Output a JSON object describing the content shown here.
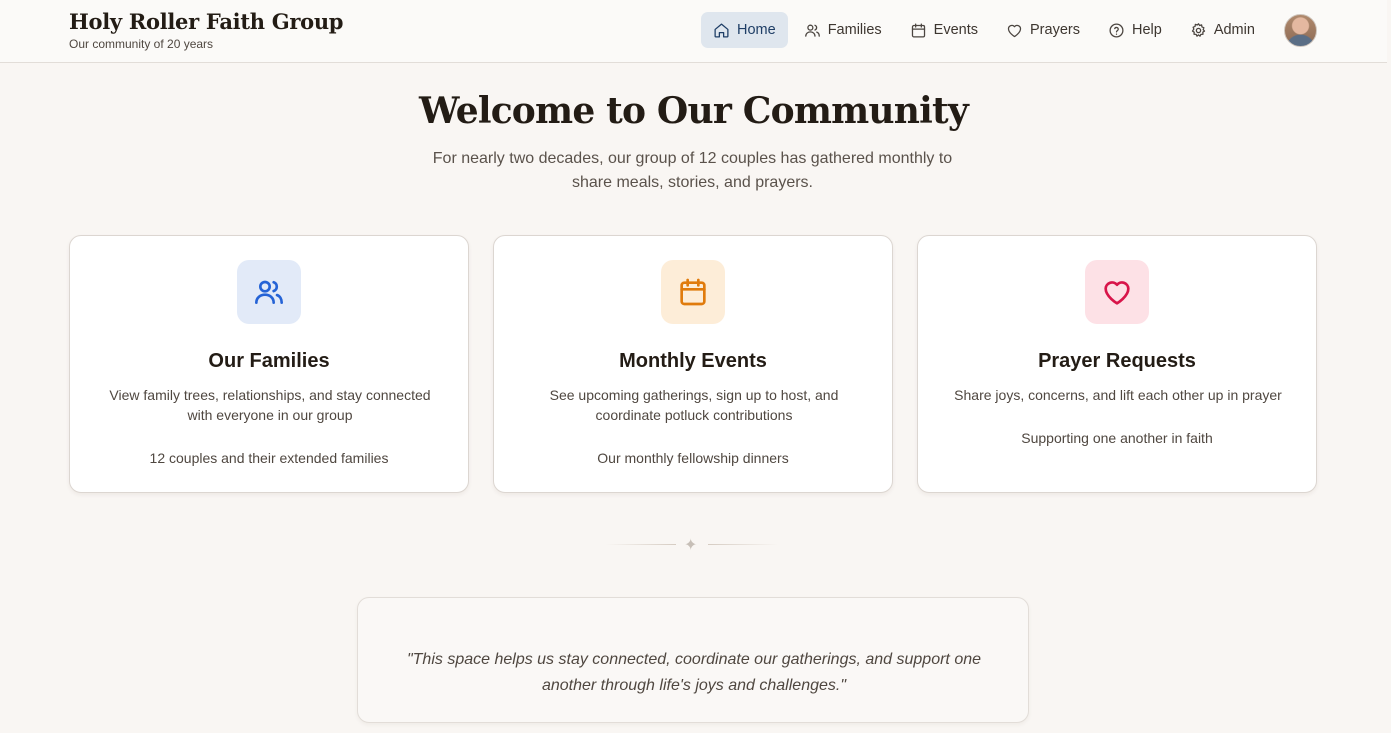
{
  "brand": {
    "title": "Holy Roller Faith Group",
    "subtitle": "Our community of 20 years"
  },
  "nav": {
    "items": [
      {
        "label": "Home",
        "icon": "home-icon",
        "active": true
      },
      {
        "label": "Families",
        "icon": "users-icon",
        "active": false
      },
      {
        "label": "Events",
        "icon": "calendar-icon",
        "active": false
      },
      {
        "label": "Prayers",
        "icon": "heart-icon",
        "active": false
      },
      {
        "label": "Help",
        "icon": "help-circle-icon",
        "active": false
      },
      {
        "label": "Admin",
        "icon": "gear-icon",
        "active": false
      }
    ],
    "active_color": "#1f3e66"
  },
  "hero": {
    "title": "Welcome to Our Community",
    "subtitle": "For nearly two decades, our group of 12 couples has gathered monthly to share meals, stories, and prayers."
  },
  "cards": [
    {
      "icon": "users-icon",
      "icon_color": "#2563d6",
      "icon_bg": "#e2eaf8",
      "title": "Our Families",
      "description": "View family trees, relationships, and stay connected with everyone in our group",
      "footer": "12 couples and their extended families"
    },
    {
      "icon": "calendar-icon",
      "icon_color": "#e07b0c",
      "icon_bg": "#fdedd8",
      "title": "Monthly Events",
      "description": "See upcoming gatherings, sign up to host, and coordinate potluck contributions",
      "footer": "Our monthly fellowship dinners"
    },
    {
      "icon": "heart-icon",
      "icon_color": "#d8154a",
      "icon_bg": "#fde1e6",
      "title": "Prayer Requests",
      "description": "Share joys, concerns, and lift each other up in prayer",
      "footer": "Supporting one another in faith"
    }
  ],
  "divider": {
    "glyph": "✦"
  },
  "quote": {
    "text": "\"This space helps us stay connected, coordinate our gatherings, and support one another through life's joys and challenges.\""
  }
}
